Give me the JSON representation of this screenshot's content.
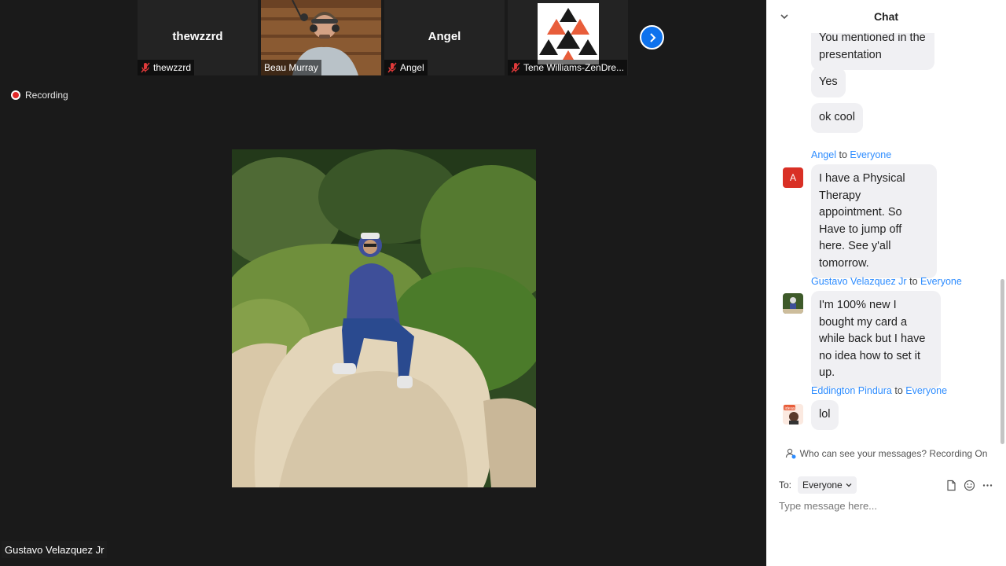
{
  "participants": [
    {
      "name": "thewzzrd",
      "label": "thewzzrd",
      "muted": true,
      "has_video": false
    },
    {
      "name": "Beau Murray",
      "label": "Beau Murray",
      "muted": false,
      "has_video": true
    },
    {
      "name": "Angel",
      "label": "Angel",
      "muted": true,
      "has_video": false
    },
    {
      "name": "Tene Williams-ZenDre...",
      "label": "Tene Williams-ZenDre...",
      "muted": true,
      "has_video": false
    }
  ],
  "next_participants_icon": "chevron-right-icon",
  "recording": {
    "label": "Recording"
  },
  "active_speaker": {
    "name": "Gustavo Velazquez Jr"
  },
  "chat": {
    "title": "Chat",
    "messages": [
      {
        "sender": "",
        "to_word": "",
        "recipient": "",
        "text": "You mentioned in the presentation"
      },
      {
        "sender": "",
        "to_word": "",
        "recipient": "",
        "text": "Yes"
      },
      {
        "sender": "",
        "to_word": "",
        "recipient": "",
        "text": "ok cool"
      },
      {
        "sender": "Angel",
        "to_word": "to",
        "recipient": "Everyone",
        "avatar_letter": "A",
        "text": "I have a Physical Therapy appointment. So Have to jump off here. See y'all tomorrow."
      },
      {
        "sender": "Gustavo Velazquez Jr",
        "to_word": "to",
        "recipient": "Everyone",
        "text": "I'm 100% new I bought my card a while back but I have no idea how to set it up."
      },
      {
        "sender": "Eddington Pindura",
        "to_word": "to",
        "recipient": "Everyone",
        "avatar_text": "ideas",
        "text": "lol"
      }
    ],
    "privacy_notice": "Who can see your messages? Recording On",
    "to_label": "To:",
    "to_selected": "Everyone",
    "input_placeholder": "Type message here...",
    "colors": {
      "accent": "#2d8cff",
      "bubble": "#f0f0f3",
      "recording": "#e02828"
    }
  }
}
